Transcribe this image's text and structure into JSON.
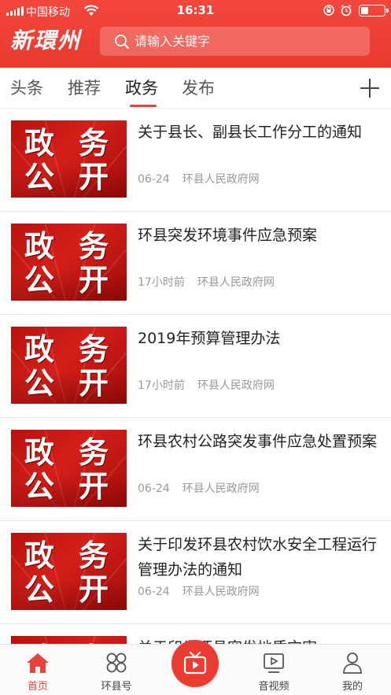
{
  "status_bar": {
    "carrier": "中国移动",
    "time": "16:31"
  },
  "header": {
    "logo_text": "新環州",
    "search_placeholder": "请输入关键字"
  },
  "tabs": [
    {
      "label": "头条"
    },
    {
      "label": "推荐"
    },
    {
      "label": "政务",
      "active": true
    },
    {
      "label": "发布"
    }
  ],
  "thumbnail": {
    "line1_a": "政",
    "line1_b": "务",
    "line2_a": "公",
    "line2_b": "开"
  },
  "feed": [
    {
      "title": "关于县长、副县长工作分工的通知",
      "date": "06-24",
      "source": "环县人民政府网"
    },
    {
      "title": "环县突发环境事件应急预案",
      "date": "17小时前",
      "source": "环县人民政府网"
    },
    {
      "title": "2019年预算管理办法",
      "date": "17小时前",
      "source": "环县人民政府网"
    },
    {
      "title": "环县农村公路突发事件应急处置预案",
      "date": "06-24",
      "source": "环县人民政府网"
    },
    {
      "title": "关于印发环县农村饮水安全工程运行管理办法的通知",
      "date": "06-24",
      "source": "环县人民政府网"
    },
    {
      "title": "关于印发环县突发地质灾害",
      "date": "",
      "source": ""
    }
  ],
  "bottom_nav": [
    {
      "label": "首页",
      "icon": "home-icon",
      "active": true
    },
    {
      "label": "环县号",
      "icon": "grid-icon"
    },
    {
      "label": "",
      "icon": "tv-icon"
    },
    {
      "label": "音视频",
      "icon": "video-icon"
    },
    {
      "label": "我的",
      "icon": "user-icon"
    }
  ],
  "colors": {
    "brand": "#ea3a30",
    "active_tab_underline": "#e8453a",
    "meta_text": "#999999"
  }
}
